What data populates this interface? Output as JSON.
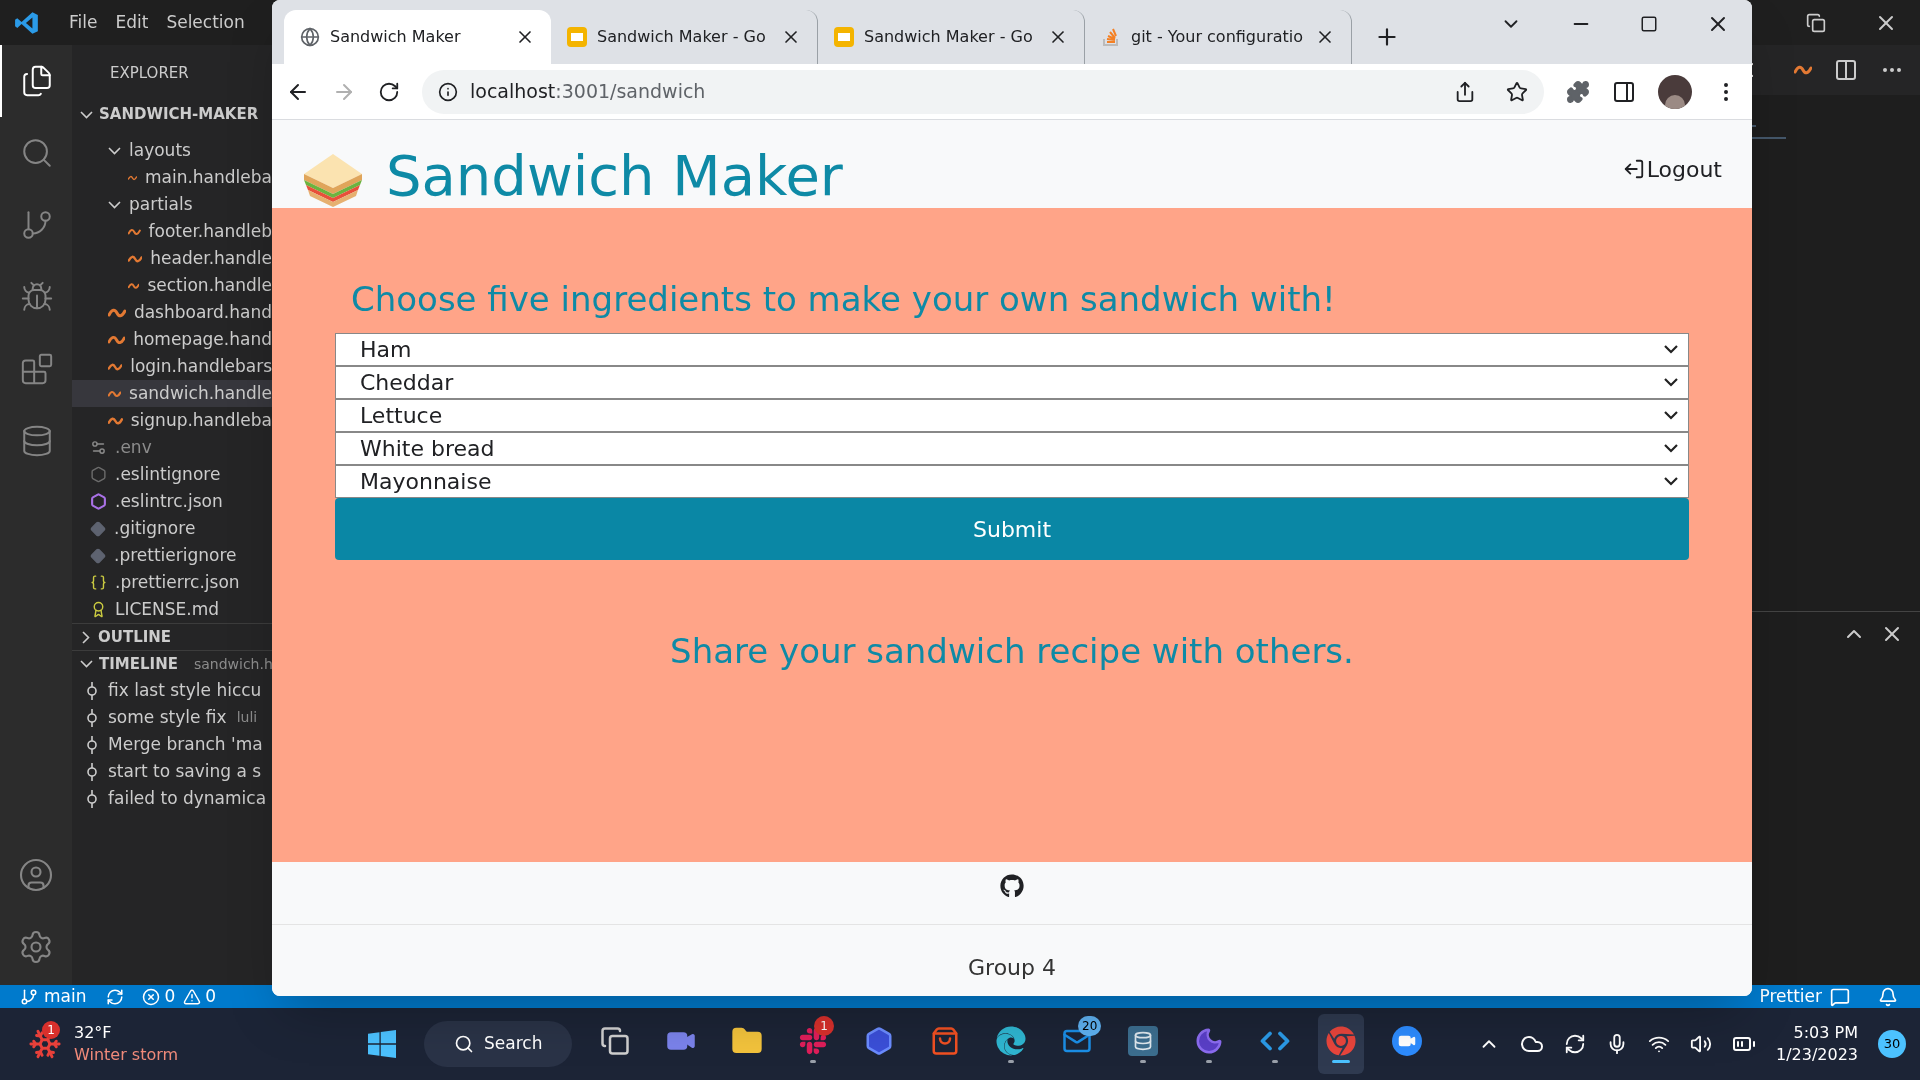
{
  "editor": {
    "menu": [
      "File",
      "Edit",
      "Selection"
    ],
    "activity_bar": [
      {
        "kind": "files",
        "selected": true
      },
      {
        "kind": "search",
        "selected": false
      },
      {
        "kind": "source-control",
        "selected": false
      },
      {
        "kind": "run",
        "selected": false
      },
      {
        "kind": "extensions",
        "selected": false
      },
      {
        "kind": "database",
        "selected": false
      }
    ],
    "explorer": {
      "title": "EXPLORER",
      "project": "SANDWICH-MAKER",
      "expanded": true,
      "folder_contents": [
        {
          "name": "layouts",
          "kind": "folder",
          "expanded": true,
          "selected": false,
          "children": [
            {
              "name": "main.handleba",
              "kind": "handlebars",
              "selected": false
            }
          ]
        },
        {
          "name": "partials",
          "kind": "folder",
          "expanded": true,
          "selected": false,
          "children": [
            {
              "name": "footer.handleb",
              "kind": "handlebars",
              "selected": false
            },
            {
              "name": "header.handle",
              "kind": "handlebars",
              "selected": false
            },
            {
              "name": "section.handle",
              "kind": "handlebars",
              "selected": false
            }
          ]
        },
        {
          "name": "dashboard.hand",
          "kind": "handlebars",
          "selected": false
        },
        {
          "name": "homepage.hand",
          "kind": "handlebars",
          "selected": false
        },
        {
          "name": "login.handlebars",
          "kind": "handlebars",
          "selected": false
        },
        {
          "name": "sandwich.handle",
          "kind": "handlebars",
          "selected": true
        },
        {
          "name": "signup.handleba",
          "kind": "handlebars",
          "selected": false
        }
      ],
      "root_files": [
        {
          "name": ".env",
          "kind": "env",
          "ignored": true
        },
        {
          "name": ".eslintignore",
          "kind": "eslint-ignore",
          "ignored": false
        },
        {
          "name": ".eslintrc.json",
          "kind": "eslint",
          "ignored": false
        },
        {
          "name": ".gitignore",
          "kind": "git-ignore",
          "ignored": false
        },
        {
          "name": ".prettierignore",
          "kind": "git-ignore",
          "ignored": false
        },
        {
          "name": ".prettierrc.json",
          "kind": "json",
          "ignored": false
        },
        {
          "name": "LICENSE.md",
          "kind": "license",
          "ignored": false
        }
      ]
    },
    "outline": {
      "title": "OUTLINE",
      "expanded": false
    },
    "timeline": {
      "title": "TIMELINE",
      "expanded": true,
      "file": "sandwich.h",
      "entries": [
        {
          "message": "fix last style hiccu"
        },
        {
          "message": "some style fix",
          "author": "luli"
        },
        {
          "message": "Merge branch 'ma"
        },
        {
          "message": "start to saving a s"
        },
        {
          "message": "failed to dynamica"
        }
      ]
    },
    "status_bar": {
      "branch": "main",
      "errors": "0",
      "warnings": "0",
      "formatter": "Prettier"
    }
  },
  "browser": {
    "tabs": [
      {
        "title": "Sandwich Maker",
        "kind": "globe",
        "selected": true
      },
      {
        "title": "Sandwich Maker - Go",
        "kind": "slides",
        "selected": false
      },
      {
        "title": "Sandwich Maker - Go",
        "kind": "slides",
        "selected": false
      },
      {
        "title": "git - Your configuratio",
        "kind": "stack",
        "selected": false
      }
    ],
    "address": {
      "host": "localhost",
      "path": ":3001/sandwich"
    },
    "page": {
      "title": "Sandwich Maker",
      "logout": "Logout",
      "heading": "Choose five ingredients to make your own sandwich with!",
      "selects": [
        "Ham",
        "Cheddar",
        "Lettuce",
        "White bread",
        "Mayonnaise"
      ],
      "submit": "Submit",
      "share": "Share your sandwich recipe with others.",
      "footer": "Group 4"
    }
  },
  "taskbar": {
    "weather": {
      "temperature": "32°F",
      "condition": "Winter storm",
      "badge": "1"
    },
    "search": "Search",
    "apps": [
      {
        "kind": "task-view",
        "active": false
      },
      {
        "kind": "chat",
        "active": false
      },
      {
        "kind": "folder",
        "active": false
      },
      {
        "kind": "slack",
        "active": true,
        "badge": "1"
      },
      {
        "kind": "hexagon",
        "active": false
      },
      {
        "kind": "store",
        "active": false
      },
      {
        "kind": "edge",
        "active": true
      },
      {
        "kind": "mail",
        "active": false,
        "badge": "20"
      },
      {
        "kind": "database",
        "active": true
      },
      {
        "kind": "moon",
        "active": true
      },
      {
        "kind": "code",
        "active": true
      },
      {
        "kind": "chrome",
        "active": true,
        "selected": true
      },
      {
        "kind": "zoom",
        "active": false
      }
    ],
    "time": "5:03 PM",
    "date": "1/23/2023",
    "notifications": "30"
  }
}
